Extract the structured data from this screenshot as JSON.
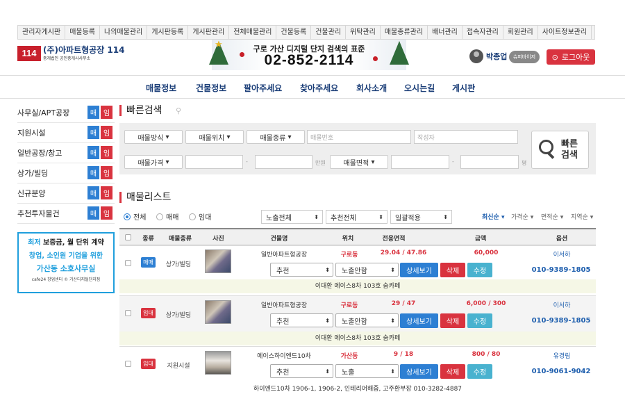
{
  "topnav": [
    "관리자게시판",
    "매물등록",
    "나의매물관리",
    "게시판등록",
    "게시판관리",
    "전체매물관리",
    "건물등록",
    "건물관리",
    "위탁관리",
    "매물종류관리",
    "배너관리",
    "접속자관리",
    "회원관리",
    "사이트정보관리"
  ],
  "logo": {
    "mark": "114",
    "name": "(주)아파트형공장 114",
    "sub": "중개법인 공인중개사사무소"
  },
  "banner": {
    "line1": "구로 가산 디지털 단지 검색의 표준",
    "phone": "02-852-2114"
  },
  "user": {
    "name": "박종업",
    "super_label": "슈퍼바이저",
    "logout_label": "로그아웃"
  },
  "mainnav": [
    "매물정보",
    "건물정보",
    "팔아주세요",
    "찾아주세요",
    "회사소개",
    "오시는길",
    "게시판"
  ],
  "sidebar": {
    "items": [
      "사무실/APT공장",
      "지원시설",
      "일반공장/창고",
      "상가/빌딩",
      "신규분양",
      "추천투자물건"
    ],
    "sale": "매",
    "rent": "임"
  },
  "ad": {
    "l1a": "최저 ",
    "l1b": "보증금, 월 단위 계약",
    "l2": "창업, 소인원 기업을 위한",
    "l3": "가산동 소호사무실",
    "l4": "cafe24 창업센터 © 가산디지털단지점"
  },
  "quick": {
    "title": "빠른검색",
    "method": "매물방식",
    "location": "매물위치",
    "type": "매물종류",
    "code_ph": "매물번호",
    "writer_ph": "작성자",
    "price": "매물가격",
    "unit_man": "만원",
    "area": "매물면적",
    "unit_py": "평",
    "dash": "-",
    "btn1": "빠른",
    "btn2": "검색"
  },
  "list": {
    "title": "매물리스트",
    "radios": [
      "전체",
      "매매",
      "임대"
    ],
    "filters": [
      "노출전체",
      "추천전체",
      "일괄적용"
    ],
    "sorts": [
      "최신순",
      "가격순",
      "면적순",
      "지역순"
    ],
    "headers": [
      "종류",
      "매물종류",
      "사진",
      "건물명",
      "위치",
      "전용면적",
      "금액",
      "옵션"
    ],
    "rows": [
      {
        "tag": "매매",
        "kind": "상가/빌딩",
        "building": "일반아파트형공장",
        "loc": "구로동",
        "area": "29.04 / 47.86",
        "price": "60,000",
        "agent": "이서하",
        "phone": "010-9389-1805",
        "s1": "추천",
        "s2": "노출안함",
        "memo": "이대환 에이스8차 103호 숨카페"
      },
      {
        "tag": "임대",
        "kind": "상가/빌딩",
        "building": "일반아파트형공장",
        "loc": "구로동",
        "area": "29 / 47",
        "price": "6,000 / 300",
        "agent": "이서하",
        "phone": "010-9389-1805",
        "s1": "추천",
        "s2": "노출안함",
        "memo": "이대환 에이스8차 103호 숨카페"
      },
      {
        "tag": "임대",
        "kind": "지원시설",
        "building": "에이스하이엔드10차",
        "loc": "가산동",
        "area": "9 / 18",
        "price": "800 / 80",
        "agent": "유경림",
        "phone": "010-9061-9042",
        "s1": "추천",
        "s2": "노출",
        "memo": "하이엔드10차 1906-1, 1906-2, 인테리어해줌, 고주환부장 010-3282-4887"
      }
    ],
    "detail": "상세보기",
    "del": "삭제",
    "edit": "수정"
  },
  "colors": {
    "red": "#d9333f",
    "blue": "#2d7fd3",
    "teal": "#49b2cf",
    "navy": "#1b3e78"
  }
}
